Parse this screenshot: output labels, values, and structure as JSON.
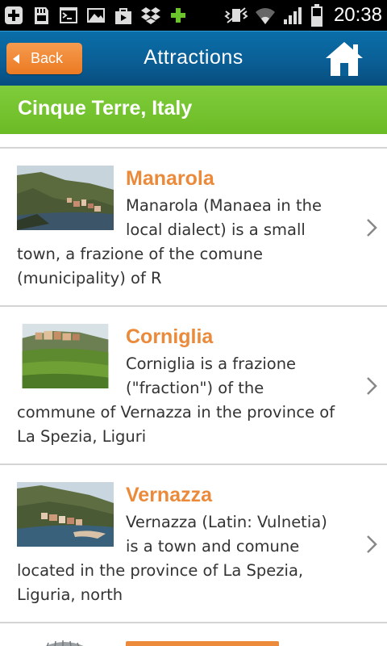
{
  "status_bar": {
    "time": "20:38",
    "icons": [
      "plus-square-icon",
      "sd-card-icon",
      "terminal-icon",
      "image-icon",
      "play-store-icon",
      "dropbox-icon",
      "green-plus-icon",
      "vibrate-icon",
      "wifi-icon",
      "signal-icon",
      "battery-icon"
    ]
  },
  "header": {
    "back_label": "Back",
    "title": "Attractions",
    "home_icon": "home-icon",
    "colors": {
      "bar": "#0a5f96",
      "back": "#ec7a22"
    }
  },
  "location": {
    "name": "Cinque Terre, Italy",
    "color": "#6bbb26"
  },
  "attractions": [
    {
      "title": "Manarola",
      "description": "Manarola (Manaea in the local dialect) is a small town, a frazione of the comune (municipality) of R",
      "image": "manarola-thumbnail"
    },
    {
      "title": "Corniglia",
      "description": "Corniglia is a frazione (\"fraction\") of the commune of Vernazza in the province of La Spezia, Liguri",
      "image": "corniglia-thumbnail"
    },
    {
      "title": "Vernazza",
      "description": "Vernazza (Latin: Vulnetia) is a town and comune located in the province of La Spezia, Liguria, north",
      "image": "vernazza-thumbnail"
    }
  ],
  "accent_title_color": "#ea8a3a"
}
